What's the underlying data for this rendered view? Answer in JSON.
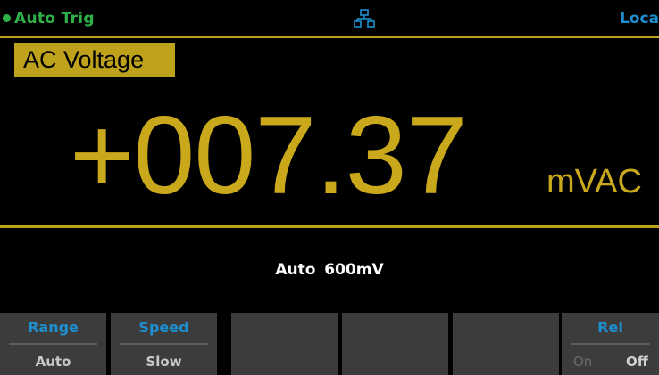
{
  "status": {
    "trigger_mode": "Auto  Trig",
    "network_icon": "network-icon",
    "remote_state": "Loca",
    "colors": {
      "trigger": "#2fb14a",
      "remote": "#1d8fcf",
      "accent": "#bfa21c"
    }
  },
  "measurement": {
    "function": "AC Voltage",
    "value": "+007.37",
    "unit": "mVAC",
    "range_info": "Auto  600mV"
  },
  "softkeys": [
    {
      "title": "Range",
      "value": "Auto"
    },
    {
      "title": "Speed",
      "value": "Slow"
    },
    {
      "title": "",
      "value": ""
    },
    {
      "title": "",
      "value": ""
    },
    {
      "title": "",
      "value": ""
    },
    {
      "title": "Rel",
      "options": [
        "On",
        "Off"
      ],
      "selected": "Off"
    }
  ]
}
